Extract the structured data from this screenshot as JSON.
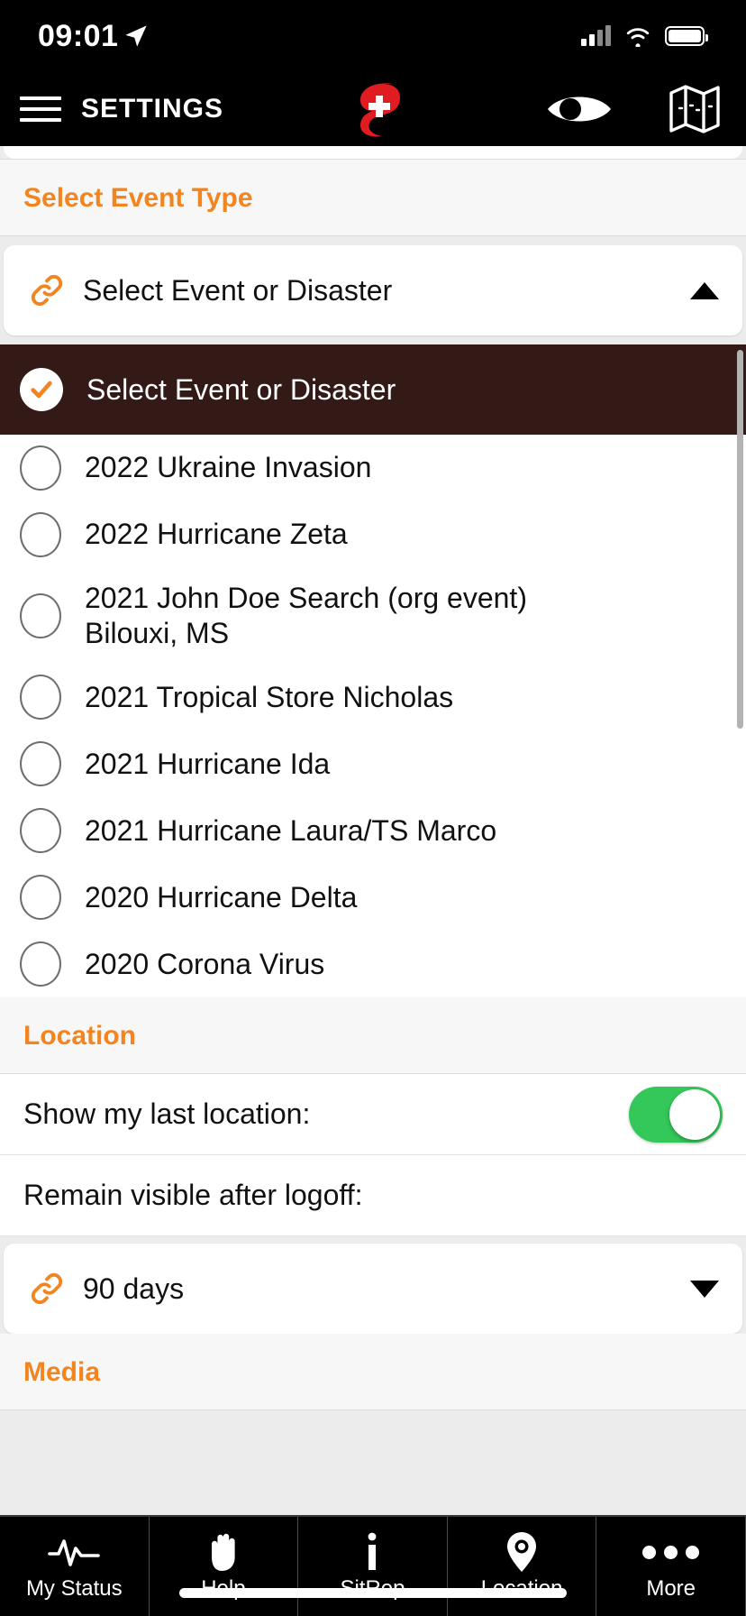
{
  "status_bar": {
    "time": "09:01",
    "location_arrow_icon": "location-arrow-icon",
    "signal_icon": "cellular-signal-icon",
    "wifi_icon": "wifi-icon",
    "battery_icon": "battery-full-icon"
  },
  "nav": {
    "menu_icon": "hamburger-menu-icon",
    "title": "SETTINGS",
    "logo_icon": "hurricane-cross-logo-icon",
    "eye_icon": "eye-visibility-icon",
    "map_icon": "map-icon"
  },
  "sections": {
    "event_type": {
      "header": "Select Event Type",
      "field": {
        "icon": "link-chain-icon",
        "value": "Select Event or Disaster",
        "caret": "chevron-up-icon"
      },
      "dropdown": {
        "selected": {
          "label": "Select Event or Disaster",
          "check_icon": "checkmark-icon"
        },
        "options": [
          "2022 Ukraine Invasion",
          "2022 Hurricane Zeta",
          "2021 John Doe Search (org event) Bilouxi, MS",
          "2021 Tropical Store Nicholas",
          "2021 Hurricane Ida",
          "2021 Hurricane Laura/TS Marco",
          "2020 Hurricane Delta",
          "2020 Corona Virus"
        ]
      }
    },
    "location": {
      "header": "Location",
      "show_last_location_label": "Show my last location:",
      "show_last_location_on": true,
      "remain_visible_label": "Remain visible after logoff:",
      "retention_field": {
        "icon": "link-chain-icon",
        "value": "90 days",
        "caret": "chevron-down-icon"
      }
    },
    "media": {
      "header": "Media"
    }
  },
  "colors": {
    "accent_orange": "#f2851f",
    "selected_row_bg": "#331a16",
    "toggle_on_green": "#34c759",
    "logo_red": "#e01b22"
  },
  "tabbar": {
    "tabs": [
      {
        "label": "My Status",
        "icon": "pulse-waveform-icon"
      },
      {
        "label": "Help",
        "icon": "raised-hand-icon"
      },
      {
        "label": "SitRep",
        "icon": "info-i-icon"
      },
      {
        "label": "Location",
        "icon": "map-pin-icon"
      },
      {
        "label": "More",
        "icon": "ellipsis-icon"
      }
    ]
  }
}
